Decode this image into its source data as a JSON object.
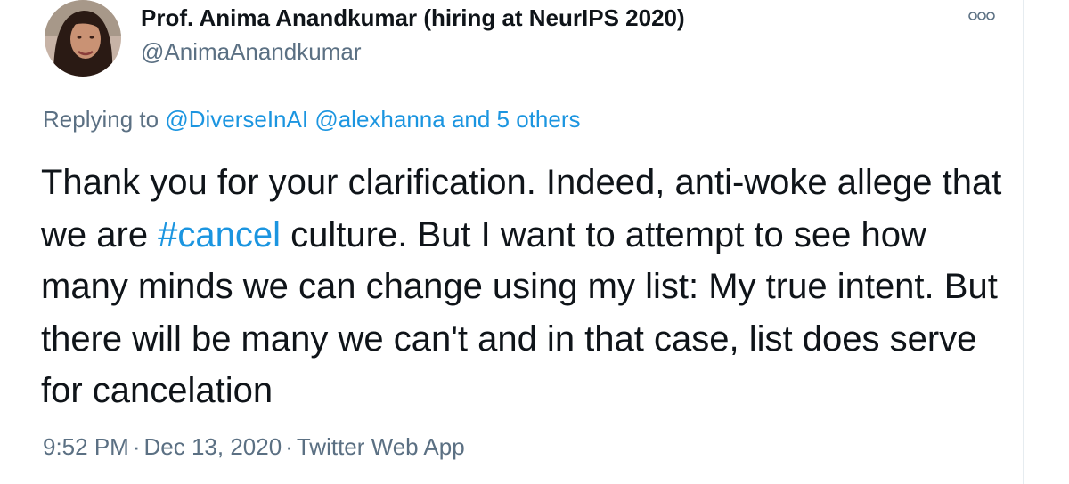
{
  "tweet": {
    "author": {
      "display_name": "Prof. Anima Anandkumar (hiring at NeurIPS 2020)",
      "handle": "@AnimaAnandkumar"
    },
    "more_icon": "more-options-icon",
    "replying": {
      "prefix": "Replying to ",
      "mention_1": "@DiverseInAI",
      "mention_2": "@alexhanna",
      "connector": " and ",
      "others": "5 others"
    },
    "text": {
      "part_1": "Thank you for your clarification. Indeed, anti-woke allege that we are ",
      "hashtag": "#cancel",
      "part_2": " culture. But I want to attempt to see how many minds we can change using my list: My true intent. But there will be many we can't and in that case, list does serve for cancelation"
    },
    "meta": {
      "time": "9:52 PM",
      "separator": "·",
      "date": "Dec 13, 2020",
      "source": "Twitter Web App"
    }
  },
  "colors": {
    "link": "#1b95e0",
    "secondary_text": "#5b7083",
    "primary_text": "#0f1419"
  }
}
